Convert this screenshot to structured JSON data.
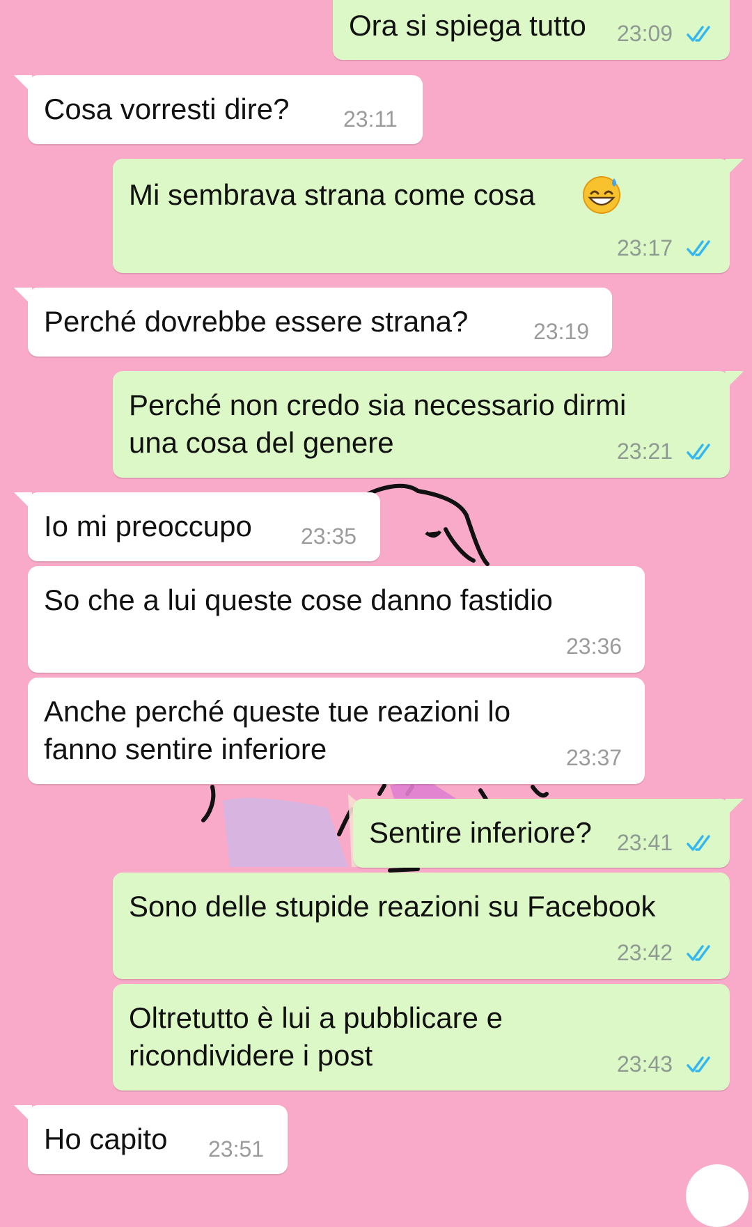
{
  "colors": {
    "background": "#f9aac8",
    "incoming_bubble": "#ffffff",
    "outgoing_bubble": "#dcf8c6",
    "timestamp": "#8e9a92",
    "read_ticks": "#34b7f1"
  },
  "messages": [
    {
      "text": "Ora si spiega tutto",
      "time": "23:09",
      "direction": "outgoing",
      "read": true
    },
    {
      "text": "Cosa vorresti dire?",
      "time": "23:11",
      "direction": "incoming"
    },
    {
      "text": "Mi sembrava strana come cosa",
      "emoji": "grinning-face-with-sweat",
      "time": "23:17",
      "direction": "outgoing",
      "read": true
    },
    {
      "text": "Perché dovrebbe essere strana?",
      "time": "23:19",
      "direction": "incoming"
    },
    {
      "text": "Perché non credo sia necessario dirmi\nuna cosa del genere",
      "time": "23:21",
      "direction": "outgoing",
      "read": true
    },
    {
      "text": "Io mi preoccupo",
      "time": "23:35",
      "direction": "incoming"
    },
    {
      "text": "So che a lui queste cose danno fastidio",
      "time": "23:36",
      "direction": "incoming"
    },
    {
      "text": "Anche perché queste tue reazioni lo\nfanno sentire inferiore",
      "time": "23:37",
      "direction": "incoming"
    },
    {
      "text": "Sentire inferiore?",
      "time": "23:41",
      "direction": "outgoing",
      "read": true
    },
    {
      "text": "Sono delle stupide reazioni su Facebook",
      "time": "23:42",
      "direction": "outgoing",
      "read": true
    },
    {
      "text": "Oltretutto è lui a pubblicare e\nricondividere i post",
      "time": "23:43",
      "direction": "outgoing",
      "read": true
    },
    {
      "text": "Ho capito",
      "time": "23:51",
      "direction": "incoming"
    }
  ]
}
